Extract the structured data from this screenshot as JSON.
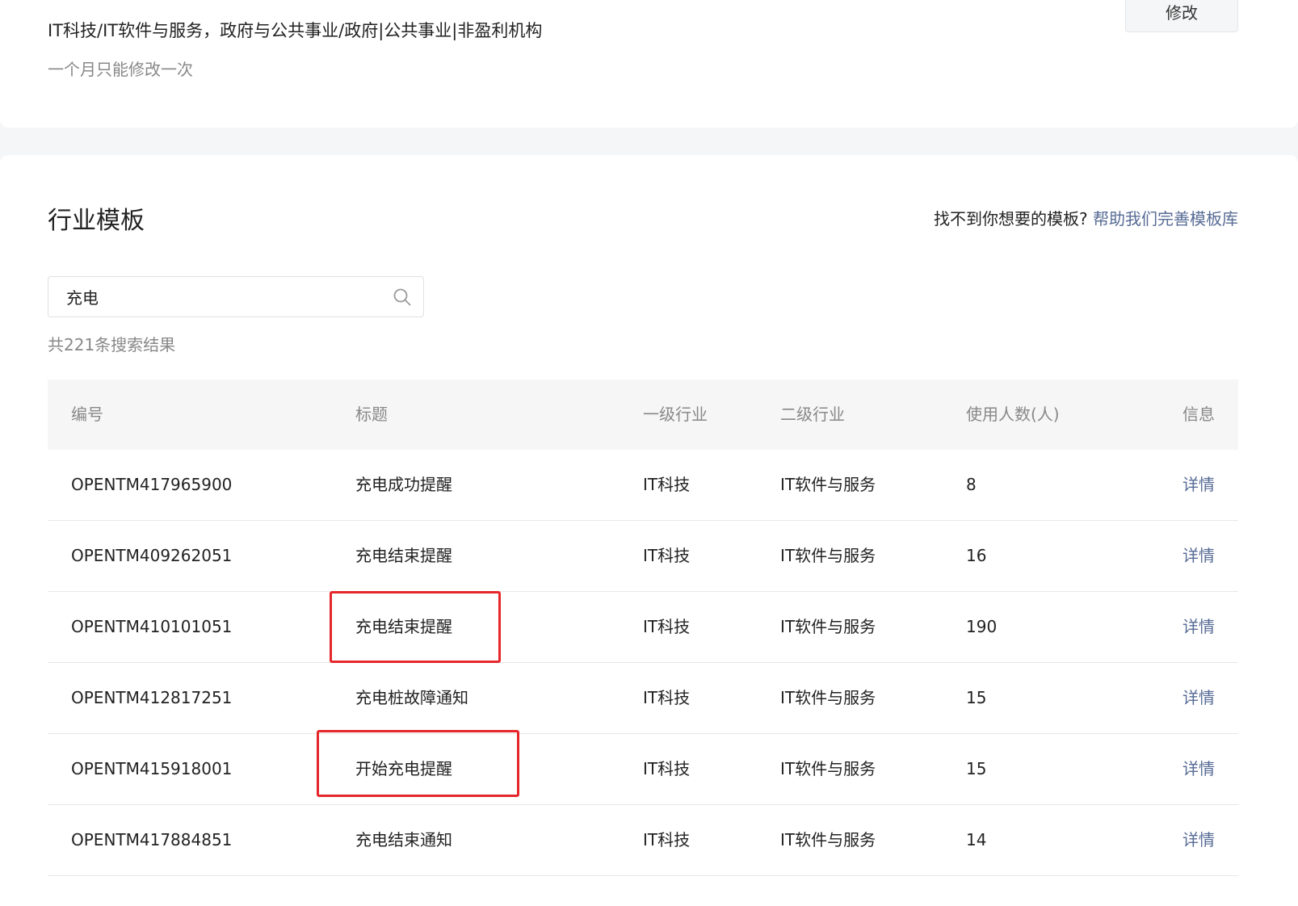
{
  "header": {
    "industry_value": "IT科技/IT软件与服务，政府与公共事业/政府|公共事业|非盈利机构",
    "modify_note": "一个月只能修改一次",
    "modify_button": "修改"
  },
  "templates": {
    "title": "行业模板",
    "help_question": "找不到你想要的模板?",
    "help_link": "帮助我们完善模板库",
    "search": {
      "value": "充电",
      "placeholder": ""
    },
    "result_count": "共221条搜索结果",
    "columns": {
      "id": "编号",
      "title": "标题",
      "level1": "一级行业",
      "level2": "二级行业",
      "users": "使用人数(人)",
      "info": "信息"
    },
    "rows": [
      {
        "id": "OPENTM417965900",
        "title": "充电成功提醒",
        "level1": "IT科技",
        "level2": "IT软件与服务",
        "users": "8",
        "info": "详情",
        "highlighted": false
      },
      {
        "id": "OPENTM409262051",
        "title": "充电结束提醒",
        "level1": "IT科技",
        "level2": "IT软件与服务",
        "users": "16",
        "info": "详情",
        "highlighted": false
      },
      {
        "id": "OPENTM410101051",
        "title": "充电结束提醒",
        "level1": "IT科技",
        "level2": "IT软件与服务",
        "users": "190",
        "info": "详情",
        "highlighted": true
      },
      {
        "id": "OPENTM412817251",
        "title": "充电桩故障通知",
        "level1": "IT科技",
        "level2": "IT软件与服务",
        "users": "15",
        "info": "详情",
        "highlighted": false
      },
      {
        "id": "OPENTM415918001",
        "title": "开始充电提醒",
        "level1": "IT科技",
        "level2": "IT软件与服务",
        "users": "15",
        "info": "详情",
        "highlighted": true
      },
      {
        "id": "OPENTM417884851",
        "title": "充电结束通知",
        "level1": "IT科技",
        "level2": "IT软件与服务",
        "users": "14",
        "info": "详情",
        "highlighted": false
      }
    ]
  },
  "colors": {
    "link": "#576b95",
    "highlight": "#e5262a",
    "muted_text": "#888888",
    "page_background": "#f5f6f7"
  },
  "icons": {
    "search": "search-icon"
  }
}
